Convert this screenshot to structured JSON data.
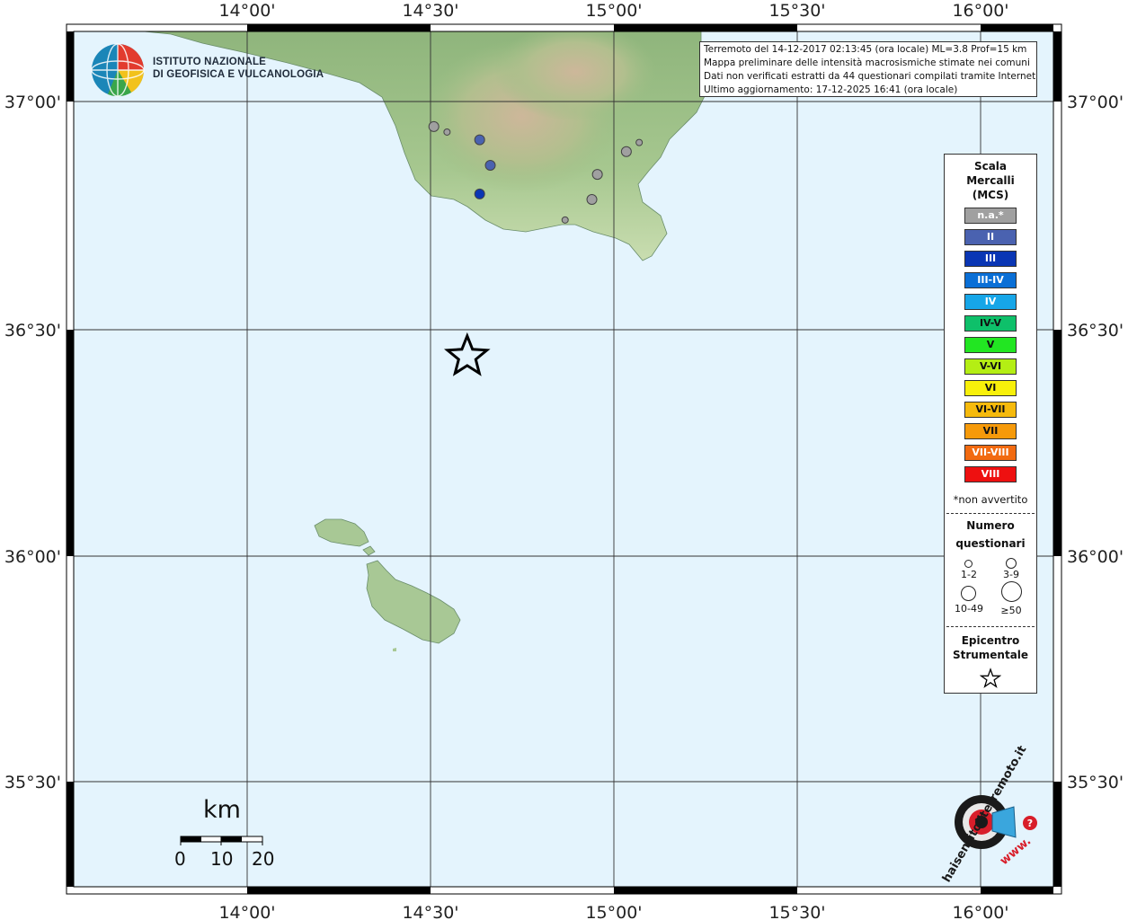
{
  "title_lines": [
    "Terremoto del 14-12-2017 02:13:45 (ora locale) ML=3.8 Prof=15 km",
    "Mappa preliminare delle intensità macrosismiche stimate nei comuni",
    "Dati non verificati estratti da 44 questionari compilati tramite Internet.",
    "Ultimo aggiornamento: 17-12-2025 16:41 (ora locale)"
  ],
  "institute": {
    "line1": "ISTITUTO NAZIONALE",
    "line2": "DI GEOFISICA E VULCANOLOGIA"
  },
  "axes": {
    "lon_labels": [
      "14°00'",
      "14°30'",
      "15°00'",
      "15°30'",
      "16°00'"
    ],
    "lat_labels": [
      "37°00'",
      "36°30'",
      "36°00'",
      "35°30'"
    ]
  },
  "legend": {
    "title": [
      "Scala",
      "Mercalli",
      "(MCS)"
    ],
    "classes": [
      {
        "label": "n.a.*",
        "color": "#a0a0a0"
      },
      {
        "label": "II",
        "color": "#4a62b0"
      },
      {
        "label": "III",
        "color": "#0a36b4"
      },
      {
        "label": "III-IV",
        "color": "#0a6fd6"
      },
      {
        "label": "IV",
        "color": "#16a6e8"
      },
      {
        "label": "IV-V",
        "color": "#0ec06a"
      },
      {
        "label": "V",
        "color": "#22e622"
      },
      {
        "label": "V-VI",
        "color": "#b4ee14"
      },
      {
        "label": "VI",
        "color": "#f8f00a"
      },
      {
        "label": "VI-VII",
        "color": "#f6ba0c"
      },
      {
        "label": "VII",
        "color": "#f69a0a"
      },
      {
        "label": "VII-VIII",
        "color": "#f26a10"
      },
      {
        "label": "VIII",
        "color": "#ee1010"
      }
    ],
    "note": "*non avvertito",
    "questionnaires_title": [
      "Numero",
      "questionari"
    ],
    "questionnaire_classes": [
      "1-2",
      "3-9",
      "10-49",
      "≥50"
    ],
    "epicenter_title": [
      "Epicentro",
      "Strumentale"
    ]
  },
  "scale_bar": {
    "unit": "km",
    "labels": [
      "0",
      "10",
      "20"
    ]
  },
  "logo_haisentito": {
    "text": "haisentitoilterremoto.it",
    "www": "www."
  },
  "epicenter": {
    "lon": 14.6,
    "lat": 36.44
  },
  "observations": [
    {
      "lon": 14.509,
      "lat": 36.945,
      "intensity": "n.a.*",
      "size": "3-9"
    },
    {
      "lon": 14.545,
      "lat": 36.933,
      "intensity": "n.a.*",
      "size": "1-2"
    },
    {
      "lon": 14.634,
      "lat": 36.916,
      "intensity": "II",
      "size": "3-9"
    },
    {
      "lon": 14.663,
      "lat": 36.86,
      "intensity": "II",
      "size": "3-9"
    },
    {
      "lon": 14.634,
      "lat": 36.797,
      "intensity": "III",
      "size": "3-9"
    },
    {
      "lon": 14.955,
      "lat": 36.84,
      "intensity": "n.a.*",
      "size": "3-9"
    },
    {
      "lon": 14.94,
      "lat": 36.785,
      "intensity": "n.a.*",
      "size": "3-9"
    },
    {
      "lon": 15.034,
      "lat": 36.89,
      "intensity": "n.a.*",
      "size": "3-9"
    },
    {
      "lon": 15.069,
      "lat": 36.91,
      "intensity": "n.a.*",
      "size": "1-2"
    },
    {
      "lon": 14.867,
      "lat": 36.74,
      "intensity": "n.a.*",
      "size": "1-2"
    }
  ]
}
